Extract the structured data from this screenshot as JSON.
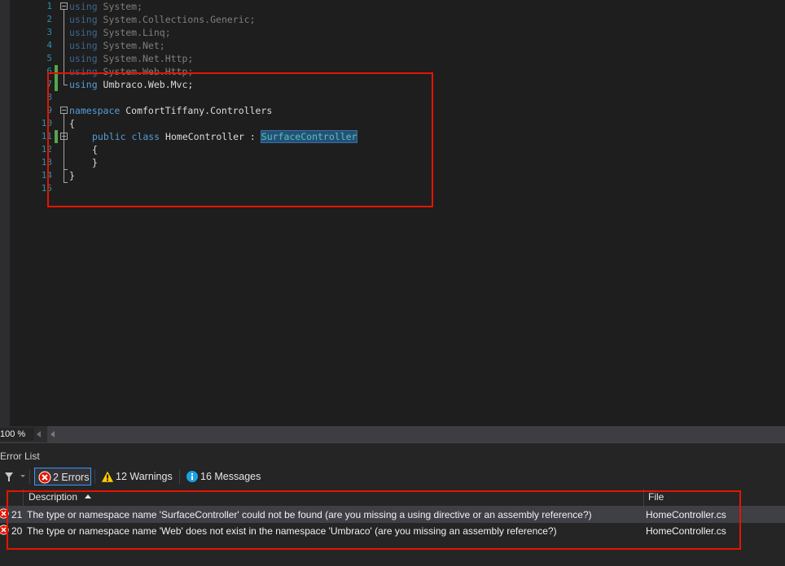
{
  "editor": {
    "line_numbers": [
      "1",
      "2",
      "3",
      "4",
      "5",
      "6",
      "7",
      "8",
      "9",
      "10",
      "11",
      "12",
      "13",
      "14",
      "15"
    ],
    "lines": [
      {
        "kw": "using",
        "rest": " System;"
      },
      {
        "kw": "using",
        "rest": " System.Collections.Generic;"
      },
      {
        "kw": "using",
        "rest": " System.Linq;"
      },
      {
        "kw": "using",
        "rest": " System.Net;"
      },
      {
        "kw": "using",
        "rest": " System.Net.Http;"
      },
      {
        "kw": "using",
        "rest": " System.Web.Http;"
      },
      {
        "kw": "using",
        "rest": " Umbraco.Web.Mvc;"
      },
      {
        "kw": "",
        "rest": ""
      },
      {
        "kw": "namespace",
        "rest": " ComfortTiffany.Controllers"
      },
      {
        "kw": "",
        "rest": "{"
      },
      {
        "kw1": "public",
        "kw2": "class",
        "name": "HomeController",
        "sep": " : ",
        "base": "SurfaceController"
      },
      {
        "kw": "",
        "rest": "{"
      },
      {
        "kw": "",
        "rest": "}"
      },
      {
        "kw": "",
        "rest": "}"
      },
      {
        "kw": "",
        "rest": ""
      }
    ]
  },
  "zoom": {
    "level": "100 %"
  },
  "error_list": {
    "title": "Error List",
    "errors_btn": "2 Errors",
    "warnings_btn": "12 Warnings",
    "messages_btn": "16 Messages",
    "columns": {
      "description": "Description",
      "file": "File"
    },
    "rows": [
      {
        "code": "21",
        "description": "The type or namespace name 'SurfaceController' could not be found (are you missing a using directive or an assembly reference?)",
        "file": "HomeController.cs"
      },
      {
        "code": "20",
        "description": "The type or namespace name 'Web' does not exist in the namespace 'Umbraco' (are you missing an assembly reference?)",
        "file": "HomeController.cs"
      }
    ]
  },
  "colors": {
    "background": "#1e1e1e",
    "keyword": "#569cd6",
    "type": "#4ec9b0",
    "line_number": "#2b91af",
    "annotation_box": "#e51400",
    "change_bar": "#57a64a"
  }
}
